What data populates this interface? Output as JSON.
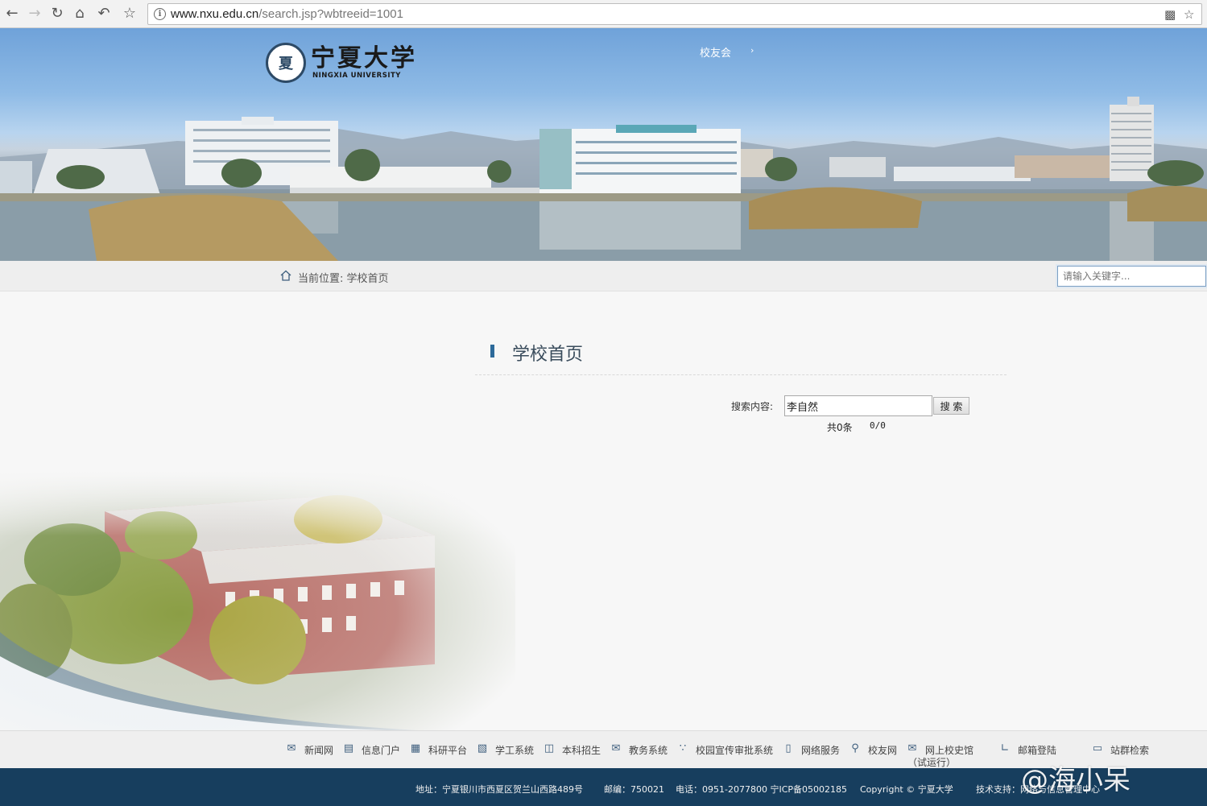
{
  "browser": {
    "url_host": "www.nxu.edu.cn",
    "url_path": "/search.jsp?wbtreeid=1001",
    "icons": [
      "back-icon",
      "forward-icon",
      "reload-icon",
      "home-icon",
      "undo-icon",
      "star-icon",
      "qr-icon"
    ]
  },
  "header": {
    "logo_cn": "宁夏大学",
    "logo_en": "NINGXIA UNIVERSITY",
    "top_link": "校友会",
    "top_link_arrow": "›"
  },
  "breadcrumb": {
    "label": "当前位置: 学校首页",
    "search_placeholder": "请输入关键字..."
  },
  "main": {
    "title": "学校首页",
    "search_label": "搜索内容:",
    "search_value": "李自然",
    "search_button": "搜 索",
    "result_count": "共0条",
    "result_pages": "0/0"
  },
  "footer_links": [
    {
      "label": "新闻网",
      "icon": "mail-icon"
    },
    {
      "label": "信息门户",
      "icon": "laptop-icon"
    },
    {
      "label": "科研平台",
      "icon": "books-icon"
    },
    {
      "label": "学工系统",
      "icon": "document-icon"
    },
    {
      "label": "本科招生",
      "icon": "monitor-icon"
    },
    {
      "label": "教务系统",
      "icon": "envelope-open-icon"
    },
    {
      "label": "校园宣传审批系统",
      "icon": "rss-icon"
    },
    {
      "label": "网络服务",
      "icon": "phone-icon"
    },
    {
      "label": "校友网",
      "icon": "search-user-icon"
    },
    {
      "label": "网上校史馆",
      "sub": "（试运行）",
      "icon": "envelope-icon"
    },
    {
      "label": "邮箱登陆",
      "icon": "chart-icon"
    },
    {
      "label": "站群检索",
      "icon": "desktop-icon"
    }
  ],
  "bottom": {
    "address": "地址：宁夏银川市西夏区贺兰山西路489号",
    "postcode": "邮编：750021",
    "phone": "电话：0951-2077800 宁ICP备05002185",
    "copyright": "Copyright © 宁夏大学",
    "support": "技术支持：网络与信息管理中心"
  },
  "watermark": "@海小呆",
  "colors": {
    "footer_bar": "#173e5e",
    "accent": "#2d6a9a"
  }
}
